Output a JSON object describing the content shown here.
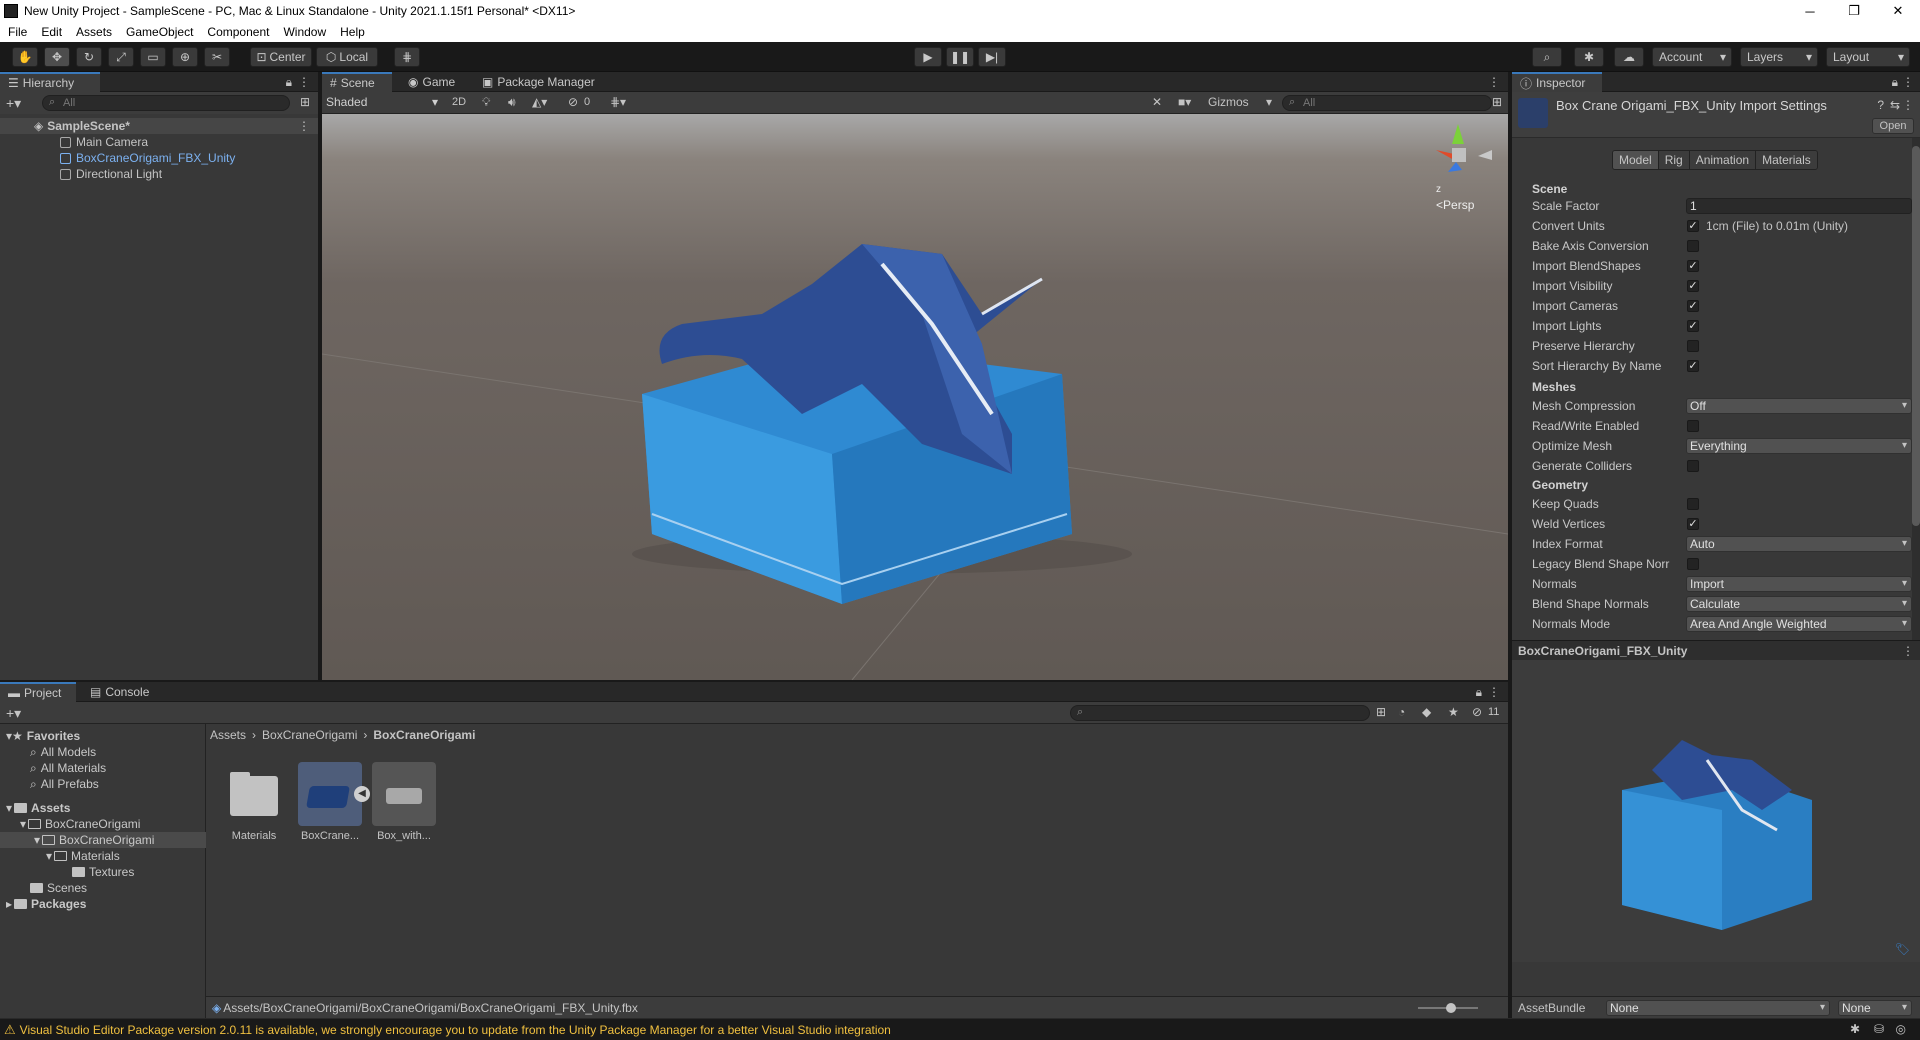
{
  "window": {
    "title": "New Unity Project - SampleScene - PC, Mac & Linux Standalone - Unity 2021.1.15f1 Personal* <DX11>",
    "controls": [
      "─",
      "❐",
      "✕"
    ]
  },
  "menu": [
    "File",
    "Edit",
    "Assets",
    "GameObject",
    "Component",
    "Window",
    "Help"
  ],
  "toolbar": {
    "pivot": "Center",
    "space": "Local",
    "account": "Account",
    "layers": "Layers",
    "layout": "Layout"
  },
  "hierarchy": {
    "tab": "Hierarchy",
    "search_placeholder": "All",
    "scene": "SampleScene*",
    "items": [
      "Main Camera",
      "BoxCraneOrigami_FBX_Unity",
      "Directional Light"
    ]
  },
  "scene_view": {
    "tabs": [
      "Scene",
      "Game",
      "Package Manager"
    ],
    "shading": "Shaded",
    "mode_2d": "2D",
    "hidden_count": "0",
    "gizmos": "Gizmos",
    "search_placeholder": "All",
    "persp": "Persp",
    "axis_z": "z"
  },
  "inspector": {
    "tab": "Inspector",
    "title": "Box Crane Origami_FBX_Unity Import Settings",
    "open_button": "Open",
    "tabs": [
      "Model",
      "Rig",
      "Animation",
      "Materials"
    ],
    "sections": {
      "scene": "Scene",
      "meshes": "Meshes",
      "geometry": "Geometry"
    },
    "scale_factor_label": "Scale Factor",
    "scale_factor_value": "1",
    "convert_units_label": "Convert Units",
    "convert_units_note": "1cm (File) to 0.01m (Unity)",
    "rows": [
      {
        "label": "Bake Axis Conversion",
        "checked": false
      },
      {
        "label": "Import BlendShapes",
        "checked": true
      },
      {
        "label": "Import Visibility",
        "checked": true
      },
      {
        "label": "Import Cameras",
        "checked": true
      },
      {
        "label": "Import Lights",
        "checked": true
      },
      {
        "label": "Preserve Hierarchy",
        "checked": false
      },
      {
        "label": "Sort Hierarchy By Name",
        "checked": true
      }
    ],
    "mesh_compression": {
      "label": "Mesh Compression",
      "value": "Off"
    },
    "read_write": {
      "label": "Read/Write Enabled",
      "checked": false
    },
    "optimize_mesh": {
      "label": "Optimize Mesh",
      "value": "Everything"
    },
    "generate_colliders": {
      "label": "Generate Colliders",
      "checked": false
    },
    "keep_quads": {
      "label": "Keep Quads",
      "checked": false
    },
    "weld_vertices": {
      "label": "Weld Vertices",
      "checked": true
    },
    "index_format": {
      "label": "Index Format",
      "value": "Auto"
    },
    "legacy_blend": {
      "label": "Legacy Blend Shape Norr",
      "checked": false
    },
    "normals": {
      "label": "Normals",
      "value": "Import"
    },
    "blend_shape_normals": {
      "label": "Blend Shape Normals",
      "value": "Calculate"
    },
    "normals_mode": {
      "label": "Normals Mode",
      "value": "Area And Angle Weighted"
    },
    "preview_title": "BoxCraneOrigami_FBX_Unity",
    "asset_bundle_label": "AssetBundle",
    "asset_bundle_value": "None",
    "asset_bundle_variant": "None"
  },
  "project": {
    "tabs": [
      "Project",
      "Console"
    ],
    "hidden_count": "11",
    "favorites": "Favorites",
    "favorite_items": [
      "All Models",
      "All Materials",
      "All Prefabs"
    ],
    "assets": "Assets",
    "tree": [
      "BoxCraneOrigami",
      "BoxCraneOrigami",
      "Materials",
      "Textures",
      "Scenes"
    ],
    "packages": "Packages",
    "breadcrumb": [
      "Assets",
      "BoxCraneOrigami",
      "BoxCraneOrigami"
    ],
    "grid": [
      "Materials",
      "BoxCrane...",
      "Box_with..."
    ],
    "path": "Assets/BoxCraneOrigami/BoxCraneOrigami/BoxCraneOrigami_FBX_Unity.fbx"
  },
  "status": {
    "message": "Visual Studio Editor Package version 2.0.11 is available, we strongly encourage you to update from the Unity Package Manager for a better Visual Studio integration"
  },
  "colors": {
    "accent": "#3a79bb",
    "selected_text": "#7cb1f0",
    "warning": "#f0c040"
  }
}
